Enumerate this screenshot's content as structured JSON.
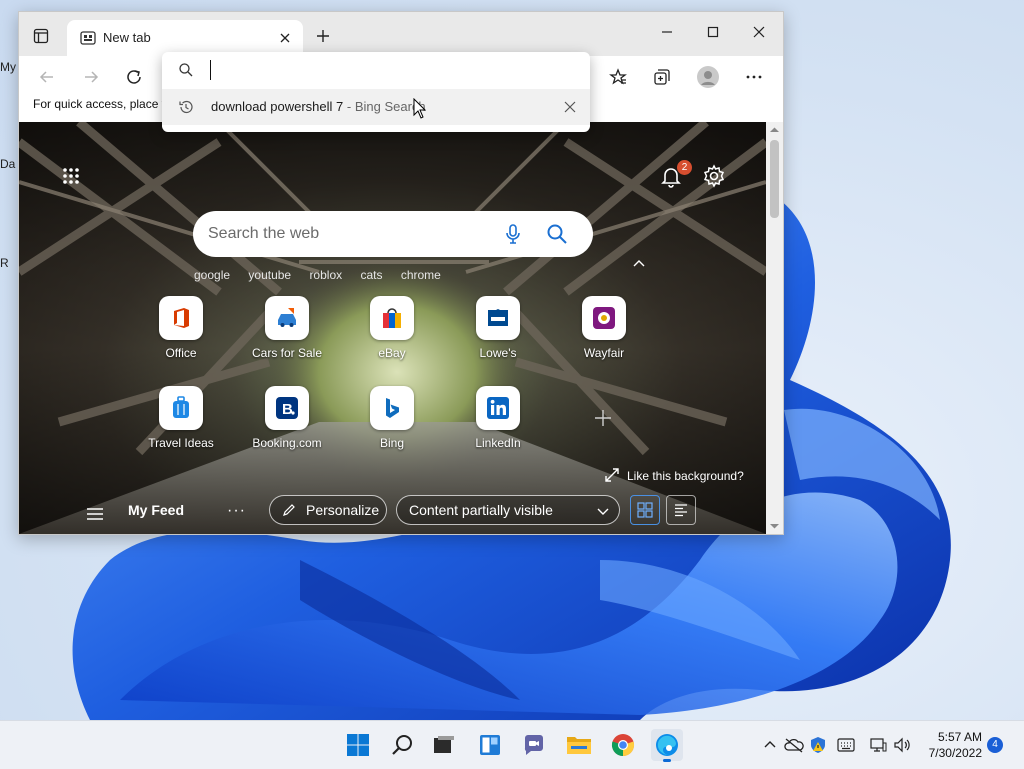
{
  "desktop": {
    "labels": [
      "My",
      "Da",
      "R"
    ]
  },
  "browser": {
    "tab": {
      "title": "New tab",
      "icon": "newtab-page-icon"
    },
    "window_controls": [
      "minimize-icon",
      "maximize-icon",
      "close-icon"
    ],
    "favorites_bar_text": "For quick access, place y",
    "address_dropdown": {
      "input_value": "",
      "suggestion": {
        "query": "download powershell 7",
        "source": " - Bing Search",
        "icon": "history-icon"
      }
    }
  },
  "newtab": {
    "search_placeholder": "Search the web",
    "quick_links": [
      "google",
      "youtube",
      "roblox",
      "cats",
      "chrome"
    ],
    "notification_count": "2",
    "tiles_row1": [
      {
        "label": "Office",
        "icon": "office-icon",
        "color": "#d83b01"
      },
      {
        "label": "Cars for Sale",
        "icon": "car-icon",
        "color": "#2d7fd3"
      },
      {
        "label": "eBay",
        "icon": "shopping-bag-icon",
        "color": "#e53238"
      },
      {
        "label": "Lowe's",
        "icon": "lowes-icon",
        "color": "#004990"
      },
      {
        "label": "Wayfair",
        "icon": "wayfair-icon",
        "color": "#7f187f"
      }
    ],
    "tiles_row2": [
      {
        "label": "Travel Ideas",
        "icon": "suitcase-icon",
        "color": "#1e88e5"
      },
      {
        "label": "Booking.com",
        "icon": "booking-icon",
        "color": "#003580"
      },
      {
        "label": "Bing",
        "icon": "bing-icon",
        "color": "#0f6cbd"
      },
      {
        "label": "LinkedIn",
        "icon": "linkedin-icon",
        "color": "#0a66c2"
      }
    ],
    "like_background": "Like this background?",
    "feed": {
      "title": "My Feed",
      "more": "···",
      "personalize": "Personalize",
      "content_select": "Content partially visible"
    }
  },
  "taskbar": {
    "apps": [
      "start-icon",
      "search-icon",
      "task-view-icon",
      "widgets-icon",
      "teams-chat-icon",
      "file-explorer-icon",
      "chrome-icon",
      "edge-icon"
    ],
    "time": "5:57 AM",
    "date": "7/30/2022",
    "notification_count": "4"
  }
}
